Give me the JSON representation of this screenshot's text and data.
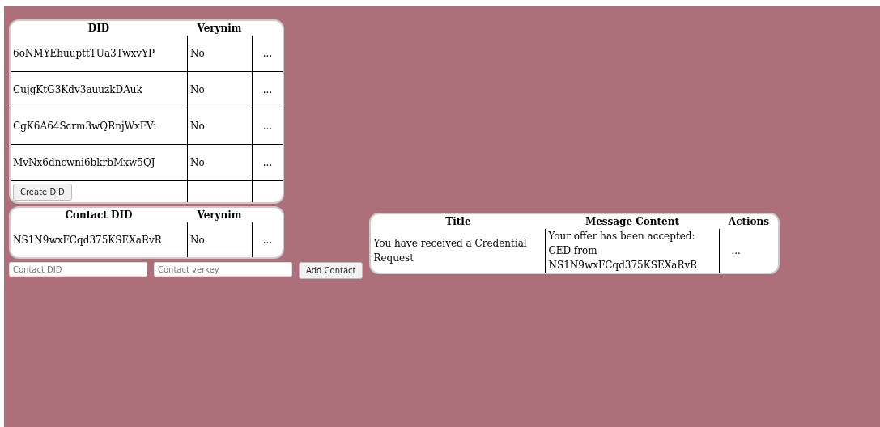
{
  "did_table": {
    "columns": [
      "DID",
      "Verynim"
    ],
    "rows": [
      {
        "did": "6oNMYEhuupttTUa3TwxvYP",
        "verynim": "No",
        "action": "..."
      },
      {
        "did": "CujgKtG3Kdv3auuzkDAuk",
        "verynim": "No",
        "action": "..."
      },
      {
        "did": "CgK6A64Scrm3wQRnjWxFVi",
        "verynim": "No",
        "action": "..."
      },
      {
        "did": "MvNx6dncwni6bkrbMxw5QJ",
        "verynim": "No",
        "action": "..."
      }
    ],
    "create_button": "Create DID"
  },
  "contact_table": {
    "columns": [
      "Contact DID",
      "Verynim"
    ],
    "rows": [
      {
        "did": "NS1N9wxFCqd375KSEXaRvR",
        "verynim": "No",
        "action": "..."
      }
    ]
  },
  "contact_form": {
    "did_placeholder": "Contact DID",
    "verkey_placeholder": "Contact verkey",
    "add_button": "Add Contact"
  },
  "messages_table": {
    "columns": [
      "Title",
      "Message Content",
      "Actions"
    ],
    "rows": [
      {
        "title": "You have received a Credential Request",
        "content": "Your offer has been accepted: CED from NS1N9wxFCqd375KSEXaRvR",
        "action": "..."
      }
    ]
  }
}
